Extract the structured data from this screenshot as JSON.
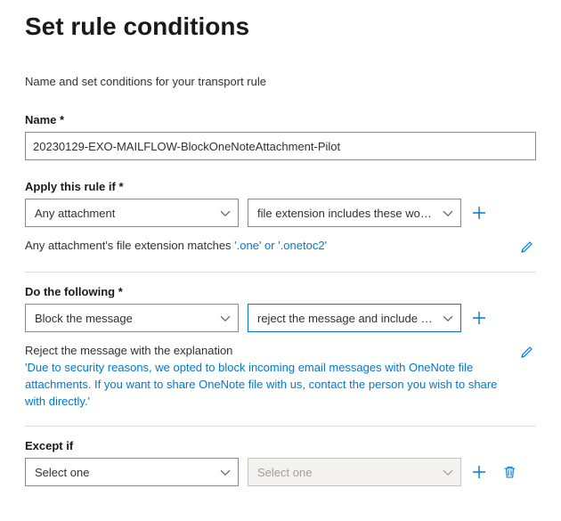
{
  "header": {
    "title": "Set rule conditions",
    "subtitle": "Name and set conditions for your transport rule"
  },
  "name_section": {
    "label": "Name *",
    "value": "20230129-EXO-MAILFLOW-BlockOneNoteAttachment-Pilot"
  },
  "apply_if": {
    "label": "Apply this rule if *",
    "dd1": "Any attachment",
    "dd2": "file extension includes these words",
    "summary_plain_1": "Any attachment's file extension matches ",
    "summary_blue_1": "'.one' or '.onetoc2'"
  },
  "do_following": {
    "label": "Do the following *",
    "dd1": "Block the message",
    "dd2": "reject the message and include an exp…",
    "summary_plain_1": "Reject the message with the explanation",
    "summary_blue_1": "'Due to security reasons, we opted to block incoming email messages with OneNote file attachments. If you want to share OneNote file with us, contact the person you wish to share with directly.'"
  },
  "except_if": {
    "label": "Except if",
    "dd1": "Select one",
    "dd2": "Select one"
  }
}
